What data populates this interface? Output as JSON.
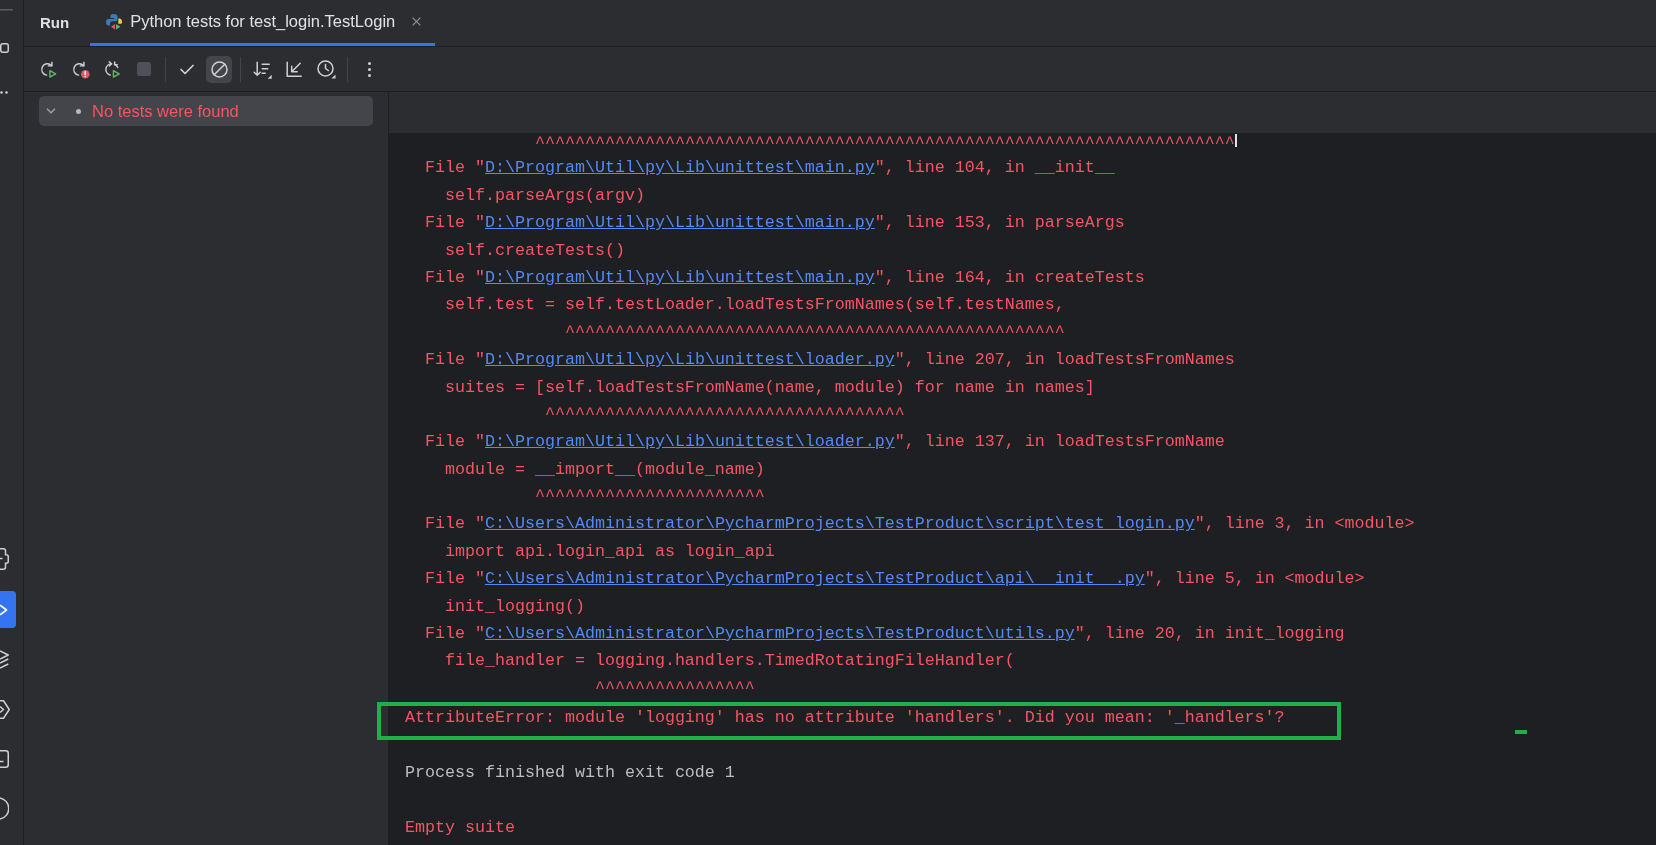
{
  "tool_strip": {
    "top": [
      {
        "kind": "line",
        "selected": false
      },
      {
        "kind": "project",
        "selected": false
      },
      {
        "kind": "more",
        "selected": false
      }
    ],
    "bottom": [
      {
        "kind": "python_console",
        "selected": false
      },
      {
        "kind": "run",
        "selected": true
      },
      {
        "kind": "layers",
        "selected": false
      },
      {
        "kind": "services",
        "selected": false
      },
      {
        "kind": "terminal",
        "selected": false
      },
      {
        "kind": "problems",
        "selected": false
      }
    ]
  },
  "tool_window": {
    "title": "Run"
  },
  "tabs": [
    {
      "label": "Python tests for test_login.TestLogin",
      "selected": true,
      "closable": true
    }
  ],
  "toolbar": {
    "groups": [
      {
        "buttons": [
          {
            "kind": "rerun",
            "selected": false,
            "disabled": false
          },
          {
            "kind": "rerun_failed",
            "selected": false,
            "disabled": false
          },
          {
            "kind": "rerun_toggle",
            "selected": false,
            "disabled": false
          },
          {
            "kind": "stop",
            "selected": false,
            "disabled": true
          }
        ]
      },
      {
        "buttons": [
          {
            "kind": "show_passed",
            "selected": false,
            "disabled": false
          },
          {
            "kind": "show_ignored",
            "selected": true,
            "disabled": false
          }
        ]
      },
      {
        "buttons": [
          {
            "kind": "sort",
            "selected": false,
            "disabled": false
          },
          {
            "kind": "import",
            "selected": false,
            "disabled": false
          },
          {
            "kind": "history",
            "selected": false,
            "disabled": false
          }
        ]
      },
      {
        "buttons": [
          {
            "kind": "more",
            "selected": false,
            "disabled": false
          }
        ]
      }
    ]
  },
  "test_tree": [
    {
      "label": "No tests were found",
      "failed": true,
      "expanded": true,
      "selected": true
    }
  ],
  "console": {
    "lines": [
      {
        "kind": "caret",
        "text": "             ^^^^^^^^^^^^^^^^^^^^^^^^^^^^^^^^^^^^^^^^^^^^^^^^^^^^^^^^^^^^^^^^^^^^^^",
        "cursor": true
      },
      {
        "kind": "file",
        "prefix": "  File \"",
        "path": "D:\\Program\\Util\\py\\Lib\\unittest\\main.py",
        "suffix": "\", line 104, in __init__",
        "cursor": false
      },
      {
        "kind": "code",
        "text": "    self.parseArgs(argv)",
        "cursor": false
      },
      {
        "kind": "file",
        "prefix": "  File \"",
        "path": "D:\\Program\\Util\\py\\Lib\\unittest\\main.py",
        "suffix": "\", line 153, in parseArgs",
        "cursor": false
      },
      {
        "kind": "code",
        "text": "    self.createTests()",
        "cursor": false
      },
      {
        "kind": "file",
        "prefix": "  File \"",
        "path": "D:\\Program\\Util\\py\\Lib\\unittest\\main.py",
        "suffix": "\", line 164, in createTests",
        "cursor": false
      },
      {
        "kind": "code",
        "text": "    self.test = self.testLoader.loadTestsFromNames(self.testNames,",
        "cursor": false
      },
      {
        "kind": "caret",
        "text": "                ^^^^^^^^^^^^^^^^^^^^^^^^^^^^^^^^^^^^^^^^^^^^^^^^^^",
        "cursor": false
      },
      {
        "kind": "file",
        "prefix": "  File \"",
        "path": "D:\\Program\\Util\\py\\Lib\\unittest\\loader.py",
        "suffix": "\", line 207, in loadTestsFromNames",
        "cursor": false
      },
      {
        "kind": "code",
        "text": "    suites = [self.loadTestsFromName(name, module) for name in names]",
        "cursor": false
      },
      {
        "kind": "caret",
        "text": "              ^^^^^^^^^^^^^^^^^^^^^^^^^^^^^^^^^^^^",
        "cursor": false
      },
      {
        "kind": "file",
        "prefix": "  File \"",
        "path": "D:\\Program\\Util\\py\\Lib\\unittest\\loader.py",
        "suffix": "\", line 137, in loadTestsFromName",
        "cursor": false
      },
      {
        "kind": "code",
        "text": "    module = __import__(module_name)",
        "cursor": false
      },
      {
        "kind": "caret",
        "text": "             ^^^^^^^^^^^^^^^^^^^^^^^",
        "cursor": false
      },
      {
        "kind": "file",
        "prefix": "  File \"",
        "path": "C:\\Users\\Administrator\\PycharmProjects\\TestProduct\\script\\test_login.py",
        "suffix": "\", line 3, in <module>",
        "cursor": false
      },
      {
        "kind": "code",
        "text": "    import api.login_api as login_api",
        "cursor": false
      },
      {
        "kind": "file",
        "prefix": "  File \"",
        "path": "C:\\Users\\Administrator\\PycharmProjects\\TestProduct\\api\\__init__.py",
        "suffix": "\", line 5, in <module>",
        "cursor": false
      },
      {
        "kind": "code",
        "text": "    init_logging()",
        "cursor": false
      },
      {
        "kind": "file",
        "prefix": "  File \"",
        "path": "C:\\Users\\Administrator\\PycharmProjects\\TestProduct\\utils.py",
        "suffix": "\", line 20, in init_logging",
        "cursor": false
      },
      {
        "kind": "code",
        "text": "    file_handler = logging.handlers.TimedRotatingFileHandler(",
        "cursor": false
      },
      {
        "kind": "caret",
        "text": "                   ^^^^^^^^^^^^^^^^",
        "cursor": false
      }
    ],
    "error": {
      "text": "AttributeError: module 'logging' has no attribute 'handlers'. Did you mean: '_handlers'?",
      "highlighted": true
    },
    "messages": [
      {
        "kind": "info",
        "text": "Process finished with exit code 1"
      },
      {
        "kind": "error",
        "text": "Empty suite"
      }
    ]
  }
}
